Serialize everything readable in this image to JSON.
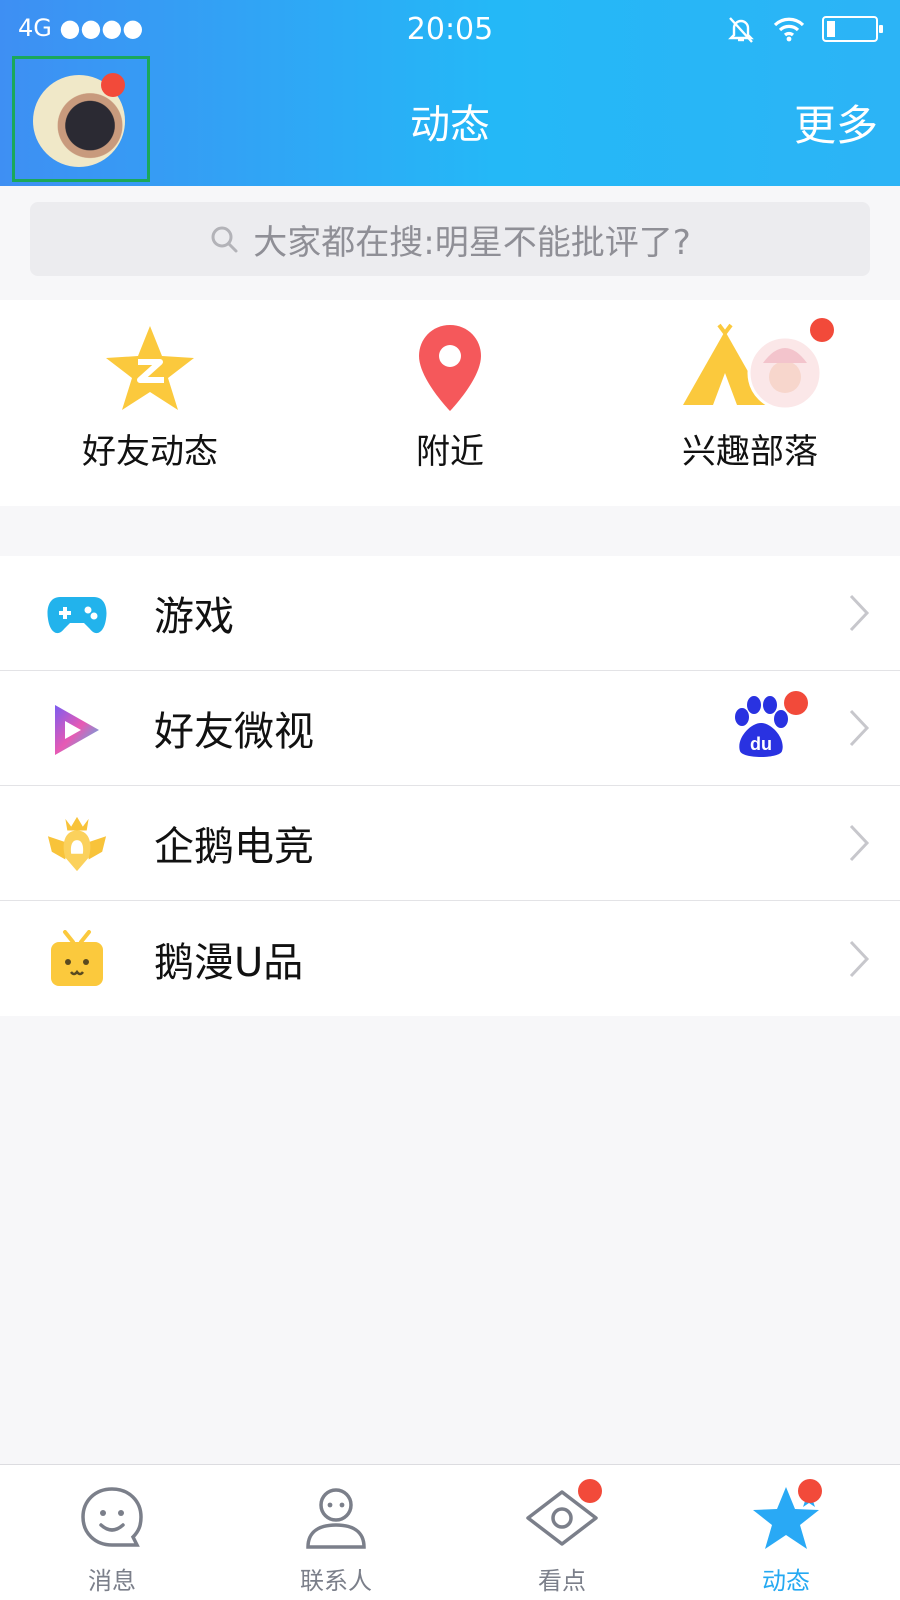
{
  "status_bar": {
    "network": "4G ●●●●",
    "time": "20:05"
  },
  "header": {
    "title": "动态",
    "more_label": "更多"
  },
  "search": {
    "placeholder": "大家都在搜:明星不能批评了?"
  },
  "shortcuts": [
    {
      "label": "好友动态",
      "icon": "qzone-star-icon"
    },
    {
      "label": "附近",
      "icon": "location-pin-icon"
    },
    {
      "label": "兴趣部落",
      "icon": "tent-icon",
      "has_badge": true
    }
  ],
  "list_items": [
    {
      "label": "游戏",
      "icon": "gamepad-icon"
    },
    {
      "label": "好友微视",
      "icon": "weishi-play-icon",
      "badge": "du",
      "has_badge": true
    },
    {
      "label": "企鹅电竞",
      "icon": "esports-crest-icon"
    },
    {
      "label": "鹅漫U品",
      "icon": "gift-box-icon"
    }
  ],
  "tabbar": [
    {
      "label": "消息",
      "icon": "chat-smile-icon"
    },
    {
      "label": "联系人",
      "icon": "person-icon"
    },
    {
      "label": "看点",
      "icon": "eye-icon",
      "has_badge": true
    },
    {
      "label": "动态",
      "icon": "star-icon",
      "active": true,
      "has_badge": true
    }
  ],
  "colors": {
    "header_start": "#3e8ff3",
    "header_end": "#2cb4f6",
    "badge_red": "#f24a3a",
    "active_tab": "#25a9f2",
    "selection_outline": "#1aa85a"
  }
}
